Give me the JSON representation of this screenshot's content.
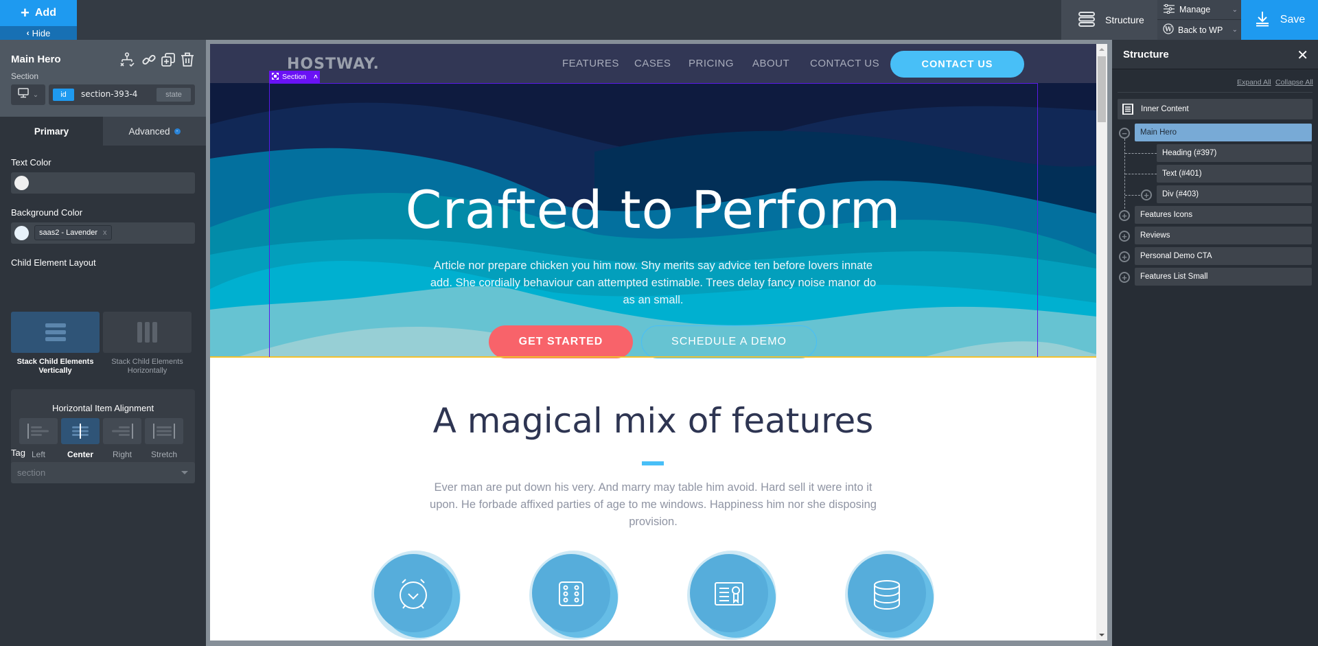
{
  "topbar": {
    "add_label": "Add",
    "hide_label": "Hide",
    "structure_label": "Structure",
    "manage_label": "Manage",
    "back_to_wp_label": "Back to WP",
    "save_label": "Save"
  },
  "left_panel": {
    "title": "Main Hero",
    "subtitle": "Section",
    "tools": [
      "structure-tree-icon",
      "link-icon",
      "duplicate-icon",
      "trash-icon"
    ],
    "device_icon": "desktop-icon",
    "id_badge": "id",
    "id_value": "section-393-4",
    "state_label": "state",
    "tabs": [
      {
        "label": "Primary",
        "active": true
      },
      {
        "label": "Advanced",
        "active": false
      }
    ],
    "text_color_label": "Text Color",
    "text_color_value": "#f0f0f0",
    "background_color_label": "Background Color",
    "background_color_value": "#e8f2fa",
    "background_color_chip": "saas2 - Lavender",
    "background_color_chip_remove": "x",
    "child_layout_label": "Child Element Layout",
    "child_layout_options": [
      {
        "label": "Stack Child Elements Vertically",
        "active": true
      },
      {
        "label": "Stack Child Elements Horizontally",
        "active": false
      }
    ],
    "alignment_label": "Horizontal Item Alignment",
    "alignment_options": [
      {
        "label": "Left",
        "active": false
      },
      {
        "label": "Center",
        "active": true
      },
      {
        "label": "Right",
        "active": false
      },
      {
        "label": "Stretch",
        "active": false
      }
    ],
    "tag_label": "Tag",
    "tag_value": "section"
  },
  "site": {
    "logo": "HOSTWAY.",
    "nav": [
      "FEATURES",
      "CASES",
      "PRICING",
      "ABOUT",
      "CONTACT US"
    ],
    "nav_cta": "CONTACT US",
    "selection_badge": "Section",
    "hero": {
      "title": "Crafted to Perform",
      "text": "Article nor prepare chicken you him now. Shy merits say advice ten before lovers innate add. She cordially behaviour can attempted estimable. Trees delay fancy noise manor do as an small.",
      "primary_button": "GET STARTED",
      "secondary_button": "SCHEDULE A DEMO"
    },
    "features": {
      "title": "A magical mix of features",
      "text": "Ever man are put down his very. And marry may table him avoid. Hard sell it were into it upon. He forbade affixed parties of age to me windows. Happiness him nor she disposing provision.",
      "icons": [
        "alarm-clock-icon",
        "dice-icon",
        "certificate-icon",
        "database-icon"
      ]
    },
    "colors": {
      "nav_bg": "#323755",
      "cta": "#48bff7",
      "primary_button": "#f8636a",
      "selection": "#6a12f5"
    }
  },
  "right_panel": {
    "title": "Structure",
    "expand_all": "Expand All",
    "collapse_all": "Collapse All",
    "root": "Inner Content",
    "tree": [
      {
        "label": "Main Hero",
        "selected": true,
        "expanded": true,
        "children": [
          {
            "label": "Heading (#397)"
          },
          {
            "label": "Text (#401)"
          },
          {
            "label": "Div (#403)",
            "collapsed": true
          }
        ]
      },
      {
        "label": "Features Icons",
        "expanded": false
      },
      {
        "label": "Reviews",
        "expanded": false
      },
      {
        "label": "Personal Demo CTA",
        "expanded": false
      },
      {
        "label": "Features List Small",
        "expanded": false
      }
    ]
  }
}
